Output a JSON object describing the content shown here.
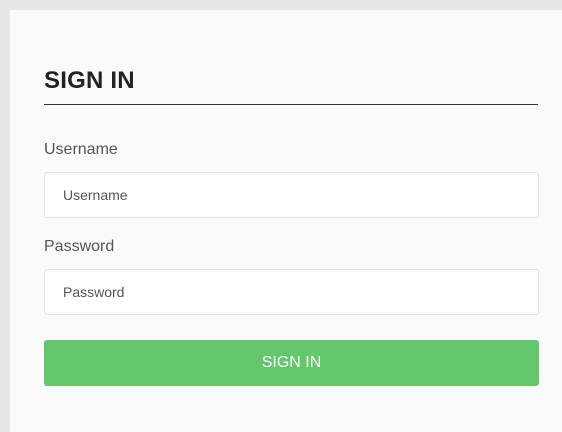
{
  "form": {
    "title": "SIGN IN",
    "username": {
      "label": "Username",
      "placeholder": "Username",
      "value": ""
    },
    "password": {
      "label": "Password",
      "placeholder": "Password",
      "value": ""
    },
    "submit_label": "SIGN IN"
  },
  "colors": {
    "page_background": "#e6e6e6",
    "panel_background": "#fafafa",
    "button_background": "#64c76b",
    "button_text": "#ffffff",
    "title_text": "#222222"
  }
}
